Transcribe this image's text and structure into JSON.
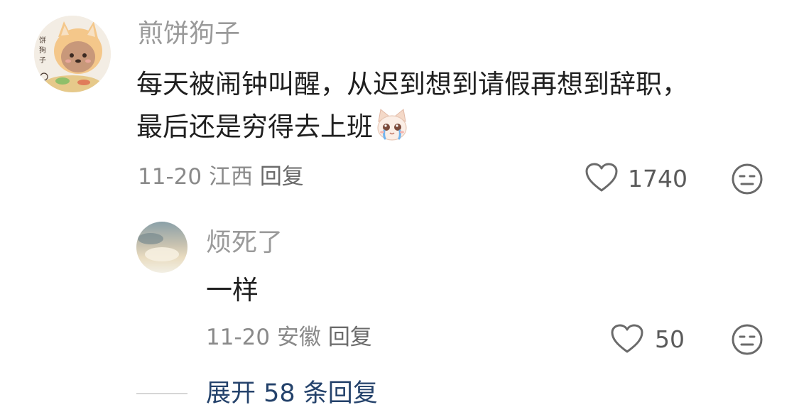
{
  "main_comment": {
    "author": "煎饼狗子",
    "avatar_text": "煎饼狗子",
    "text_line1": "每天被闹钟叫醒，从迟到想到请假再想到辞职，",
    "text_line2": "最后还是穷得去上班",
    "emoji_icon": "crying-cat-emoji-icon",
    "date": "11-20",
    "location": "江西",
    "reply_label": "回复",
    "likes": "1740"
  },
  "reply_comment": {
    "author": "烦死了",
    "text": "一样",
    "date": "11-20",
    "location": "安徽",
    "reply_label": "回复",
    "likes": "50"
  },
  "expand_replies": {
    "label": "展开 58 条回复"
  },
  "colors": {
    "author": "#9a9a9a",
    "body": "#1f1f1f",
    "meta": "#8a8a8a",
    "link": "#24426b"
  }
}
